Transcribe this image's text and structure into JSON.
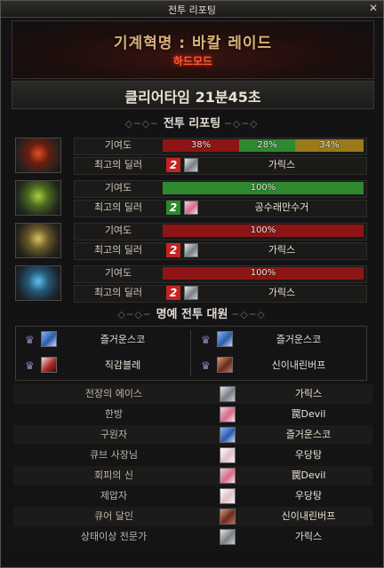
{
  "window": {
    "title": "전투 리포팅",
    "close_glyph": "✕"
  },
  "raid": {
    "name": "기계혁명 : 바칼 레이드",
    "difficulty": "하드모드"
  },
  "clear_time": "클리어타임  21분45초",
  "sections": {
    "battle_report": "전투 리포팅",
    "honor": "명예 전투 대원"
  },
  "bosses": [
    {
      "contribution_label": "기여도",
      "top_dealer_label": "최고의 딜러",
      "segments": [
        {
          "text": "38%",
          "value": 38,
          "color": "#8e1515"
        },
        {
          "text": "28%",
          "value": 28,
          "color": "#2e8a2e"
        },
        {
          "text": "34%",
          "value": 34,
          "color": "#9a7a1a"
        }
      ],
      "dealer_badge": "2",
      "dealer_badge_color": "red",
      "dealer_avatar": "silver",
      "dealer": "가릭스"
    },
    {
      "contribution_label": "기여도",
      "top_dealer_label": "최고의 딜러",
      "segments": [
        {
          "text": "100%",
          "value": 100,
          "color": "#2e8a2e"
        }
      ],
      "dealer_badge": "2",
      "dealer_badge_color": "green",
      "dealer_avatar": "pink",
      "dealer": "공수래만수거"
    },
    {
      "contribution_label": "기여도",
      "top_dealer_label": "최고의 딜러",
      "segments": [
        {
          "text": "100%",
          "value": 100,
          "color": "#8e1515"
        }
      ],
      "dealer_badge": "2",
      "dealer_badge_color": "red",
      "dealer_avatar": "silver",
      "dealer": "가릭스"
    },
    {
      "contribution_label": "기여도",
      "top_dealer_label": "최고의 딜러",
      "segments": [
        {
          "text": "100%",
          "value": 100,
          "color": "#8e1515"
        }
      ],
      "dealer_badge": "2",
      "dealer_badge_color": "red",
      "dealer_avatar": "silver",
      "dealer": "가릭스"
    }
  ],
  "honor_members": [
    {
      "name": "즐거운스코",
      "avatar": "blue"
    },
    {
      "name": "즐거운스코",
      "avatar": "blue"
    },
    {
      "name": "직감블레",
      "avatar": "red"
    },
    {
      "name": "신이내린버프",
      "avatar": "brown"
    }
  ],
  "awards": [
    {
      "title": "전장의 에이스",
      "name": "가릭스",
      "avatar": "silver"
    },
    {
      "title": "한방",
      "name": "罠Devil",
      "avatar": "pink"
    },
    {
      "title": "구원자",
      "name": "즐거운스코",
      "avatar": "blue"
    },
    {
      "title": "큐브 사장님",
      "name": "우당탕",
      "avatar": "white"
    },
    {
      "title": "회피의 신",
      "name": "罠Devil",
      "avatar": "pink"
    },
    {
      "title": "제압자",
      "name": "우당탕",
      "avatar": "white"
    },
    {
      "title": "큐어 달인",
      "name": "신이내린버프",
      "avatar": "brown"
    },
    {
      "title": "상태이상 전문가",
      "name": "가릭스",
      "avatar": "silver"
    }
  ]
}
